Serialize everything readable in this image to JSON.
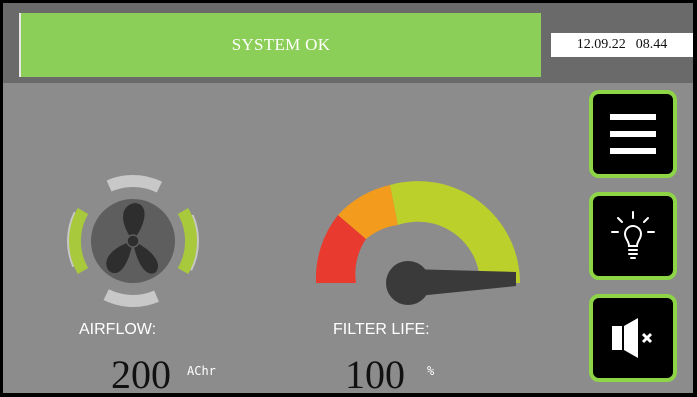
{
  "status": {
    "text": "SYSTEM OK"
  },
  "datetime": {
    "date": "12.09.22",
    "time": "08.44"
  },
  "airflow": {
    "label": "AIRFLOW:",
    "value": "200",
    "unit": "AChr"
  },
  "filter": {
    "label": "FILTER LIFE:",
    "value": "100",
    "unit": "%"
  },
  "sidebar": [
    {
      "name": "menu-button",
      "icon": "hamburger-menu-icon"
    },
    {
      "name": "light-button",
      "icon": "lightbulb-icon"
    },
    {
      "name": "mute-button",
      "icon": "speaker-mute-icon"
    }
  ],
  "colors": {
    "status_green": "#8ccf58",
    "accent_green": "#8ed447",
    "gauge_red": "#e83a2e",
    "gauge_orange": "#f29b1d",
    "gauge_green": "#bcd02c"
  }
}
